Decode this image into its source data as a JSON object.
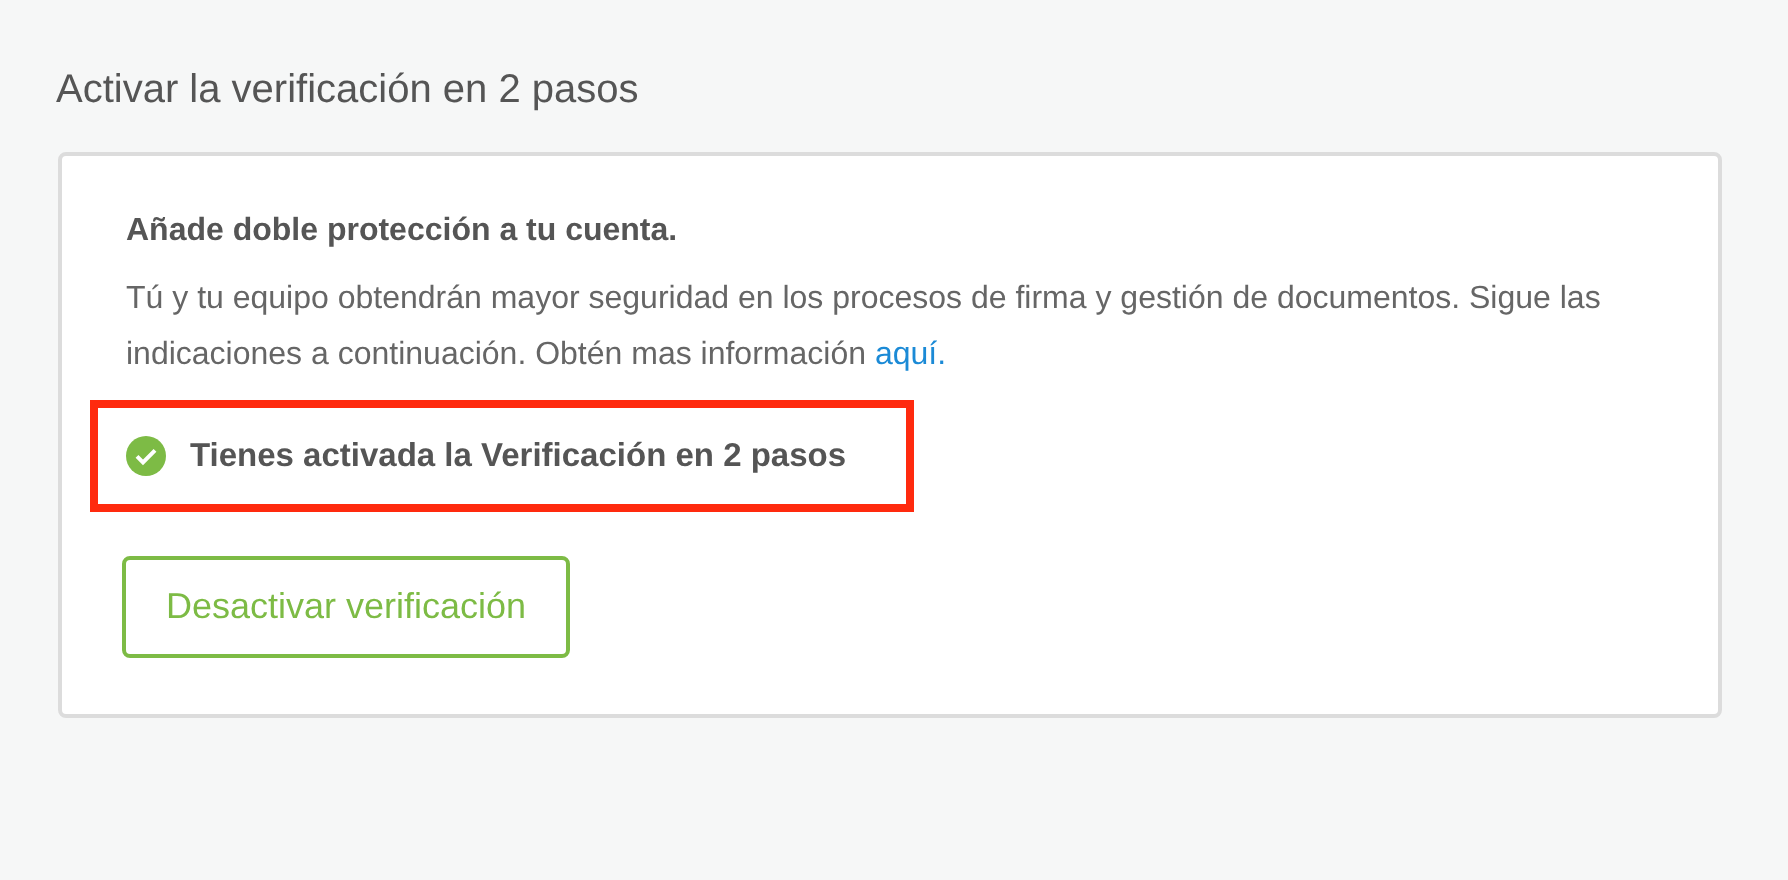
{
  "section_title": "Activar la verificación en 2 pasos",
  "card": {
    "heading": "Añade doble protección a tu cuenta.",
    "description": "Tú y tu equipo obtendrán mayor seguridad en los procesos de firma y gestión de documentos. Sigue las indicaciones a continuación. Obtén mas información",
    "link": "aquí.",
    "status": {
      "text": "Tienes activada la Verificación en 2 pasos",
      "enabled": true,
      "highlighted": true
    },
    "button": "Desactivar verificación"
  }
}
